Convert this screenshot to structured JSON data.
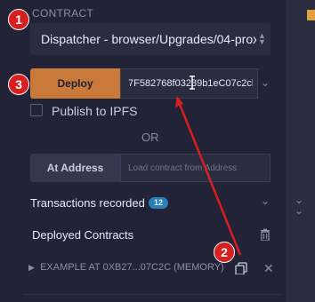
{
  "contract": {
    "section_label": "CONTRACT",
    "selected": "Dispatcher - browser/Upgrades/04-proxy.sol"
  },
  "deploy": {
    "button_label": "Deploy",
    "input_value": "7F582768f03239b1eC07c2cb"
  },
  "publish_label": "Publish to IPFS",
  "or_label": "OR",
  "at_address": {
    "button_label": "At Address",
    "placeholder": "Load contract from Address"
  },
  "transactions": {
    "label": "Transactions recorded",
    "count": "12"
  },
  "deployed": {
    "label": "Deployed Contracts"
  },
  "instance": {
    "label": "EXAMPLE AT 0XB27...07C2C (MEMORY)"
  },
  "annotations": [
    "1",
    "2",
    "3"
  ],
  "colors": {
    "background": "#222336",
    "field": "#2a2c3f",
    "deploy_button": "#c97a3a",
    "badge": "#2a7fb8",
    "annotation": "#d81f1f"
  },
  "icons": [
    "chevron-updown-icon",
    "chevron-down-icon",
    "trash-icon",
    "copy-icon",
    "close-icon",
    "chevron-right-icon",
    "double-chevron-down-icon"
  ]
}
